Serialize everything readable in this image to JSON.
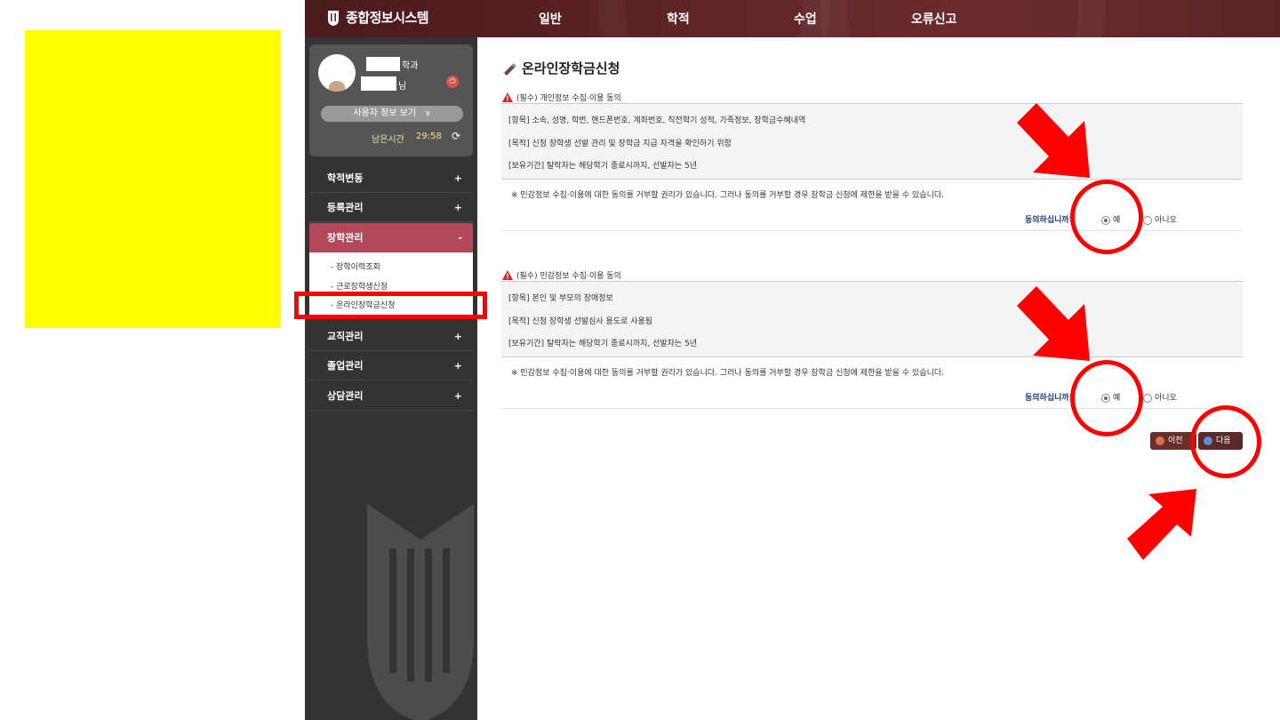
{
  "topbar": {
    "brand": "종합정보시스템",
    "menu": [
      "일반",
      "학적",
      "수업",
      "오류신고"
    ]
  },
  "profile": {
    "dept_suffix": "학과",
    "name_suffix": "님",
    "userinfo_button": "사용자 정보 보기",
    "time_label": "남은시간",
    "time_value": "29:58"
  },
  "sidebar": {
    "items": [
      {
        "label": "학적변동",
        "toggle": "+"
      },
      {
        "label": "등록관리",
        "toggle": "+"
      },
      {
        "label": "장학관리",
        "toggle": "-"
      },
      {
        "label": "교직관리",
        "toggle": "+"
      },
      {
        "label": "졸업관리",
        "toggle": "+"
      },
      {
        "label": "상담관리",
        "toggle": "+"
      }
    ],
    "submenu": [
      "- 장학이력조회",
      "- 근로장학생신청",
      "- 온라인장학금신청"
    ]
  },
  "page": {
    "title": "온라인장학금신청",
    "sections": [
      {
        "title": "(필수) 개인정보 수집·이용 동의",
        "lines": [
          "[항목] 소속, 성명, 학번, 핸드폰번호, 계좌번호, 직전학기 성적, 가족정보, 장학금수혜내역",
          "[목적] 신청 장학생 선발 관리 및 장학금 지급 자격을 확인하기 위함",
          "[보유기간] 탈락자는 해당학기 종료시까지, 선발자는 5년"
        ],
        "notice": "※ 민감정보 수집·이용에 대한 동의를 거부할 권리가 있습니다. 그러나 동의를 거부할 경우 장학금 신청에 제한을 받을 수 있습니다.",
        "agree_question": "동의하십니까?",
        "yes": "예",
        "no": "아니오",
        "selected": "yes"
      },
      {
        "title": "(필수) 민감정보 수집·이용 동의",
        "lines": [
          "[항목] 본인 및 부모의 장애정보",
          "[목적] 신청 장학생 선발심사 용도로 사용됨",
          "[보유기간] 탈락자는 해당학기 종료시까지, 선발자는 5년"
        ],
        "notice": "※ 민감정보 수집·이용에 대한 동의를 거부할 권리가 있습니다. 그러나 동의를 거부할 경우 장학금 신청에 제한을 받을 수 있습니다.",
        "agree_question": "동의하십니까?",
        "yes": "예",
        "no": "아니오",
        "selected": "yes"
      }
    ],
    "prev_button": "이전",
    "next_button": "다음"
  },
  "colors": {
    "topbar": "#5e2427",
    "sidebar": "#333333",
    "active_menu": "#b3485a",
    "annotation": "#ff0000",
    "highlight": "#ffff00"
  }
}
